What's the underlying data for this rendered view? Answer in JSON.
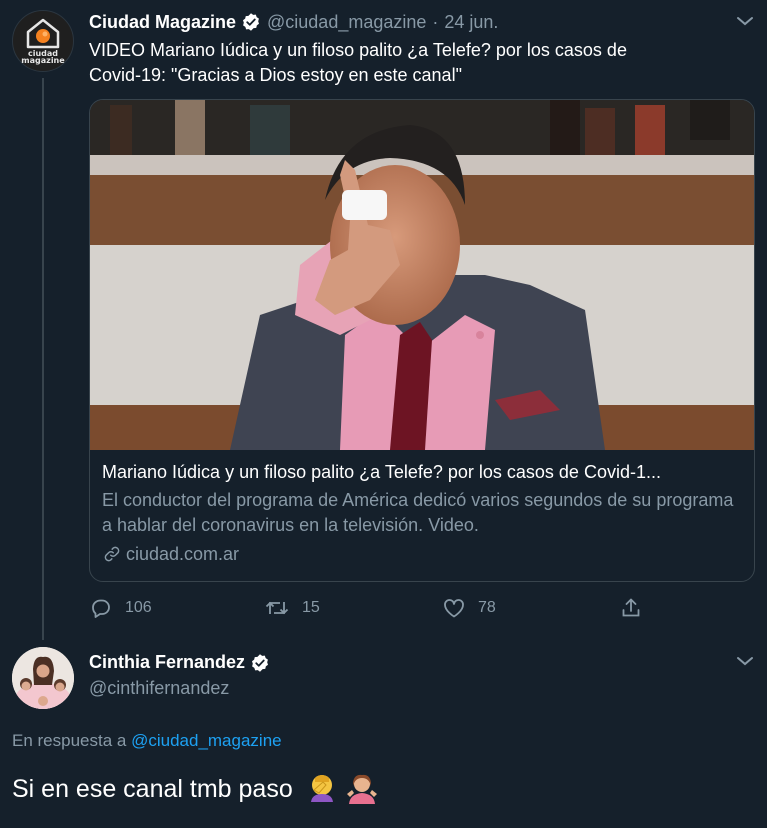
{
  "tweet": {
    "author_name": "Ciudad Magazine",
    "author_handle": "@ciudad_magazine",
    "separator": "·",
    "date": "24 jun.",
    "avatar_text_line1": "ciudad",
    "avatar_text_line2": "magazine",
    "text_line1": "VIDEO Mariano Iúdica y un filoso palito ¿a Telefe? por los casos de",
    "text_line2": "Covid-19: \"Gracias a Dios estoy en este canal\"",
    "card": {
      "title": "Mariano Iúdica y un filoso palito ¿a Telefe? por los casos de Covid-1...",
      "description": "El conductor del programa de América dedicó varios segundos de su programa a hablar del coronavirus en la televisión. Video.",
      "domain": "ciudad.com.ar"
    },
    "actions": {
      "replies": "106",
      "retweets": "15",
      "likes": "78"
    }
  },
  "reply": {
    "author_name": "Cinthia Fernandez",
    "author_handle": "@cinthifernandez",
    "reply_prefix": "En respuesta a",
    "reply_handle": "@ciudad_magazine",
    "text": "Si en ese canal tmb paso"
  },
  "colors": {
    "background": "#15202b",
    "muted": "#8899a6",
    "accent": "#1da1f2",
    "border": "#38444d",
    "text": "#ffffff"
  },
  "icons": [
    "verified-badge-icon",
    "chevron-down-icon",
    "reply-icon",
    "retweet-icon",
    "like-icon",
    "share-icon",
    "link-icon",
    "facepalm-emoji",
    "shrug-emoji"
  ]
}
